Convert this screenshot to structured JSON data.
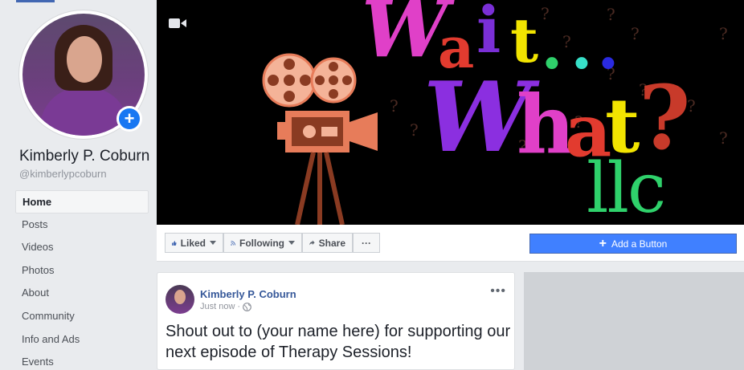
{
  "profile": {
    "name": "Kimberly P. Coburn",
    "handle": "@kimberlypcoburn"
  },
  "nav": {
    "items": [
      {
        "label": "Home"
      },
      {
        "label": "Posts"
      },
      {
        "label": "Videos"
      },
      {
        "label": "Photos"
      },
      {
        "label": "About"
      },
      {
        "label": "Community"
      },
      {
        "label": "Info and Ads"
      },
      {
        "label": "Events"
      }
    ]
  },
  "cover": {
    "line1": [
      "W",
      "a",
      "i",
      "t",
      ".",
      ".",
      "."
    ],
    "line2": [
      "W",
      "h",
      "a",
      "t",
      "?"
    ],
    "line3": "llc"
  },
  "actions": {
    "liked": "Liked",
    "following": "Following",
    "share": "Share",
    "more": "···",
    "add_button": "Add a Button"
  },
  "post": {
    "author": "Kimberly P. Coburn",
    "time": "Just now",
    "separator": "·",
    "text": "Shout out to (your name here) for supporting our next episode of Therapy Sessions!",
    "more": "•••"
  },
  "colors": {
    "accent": "#4267b2",
    "add_button": "#4080ff",
    "link": "#365899"
  }
}
